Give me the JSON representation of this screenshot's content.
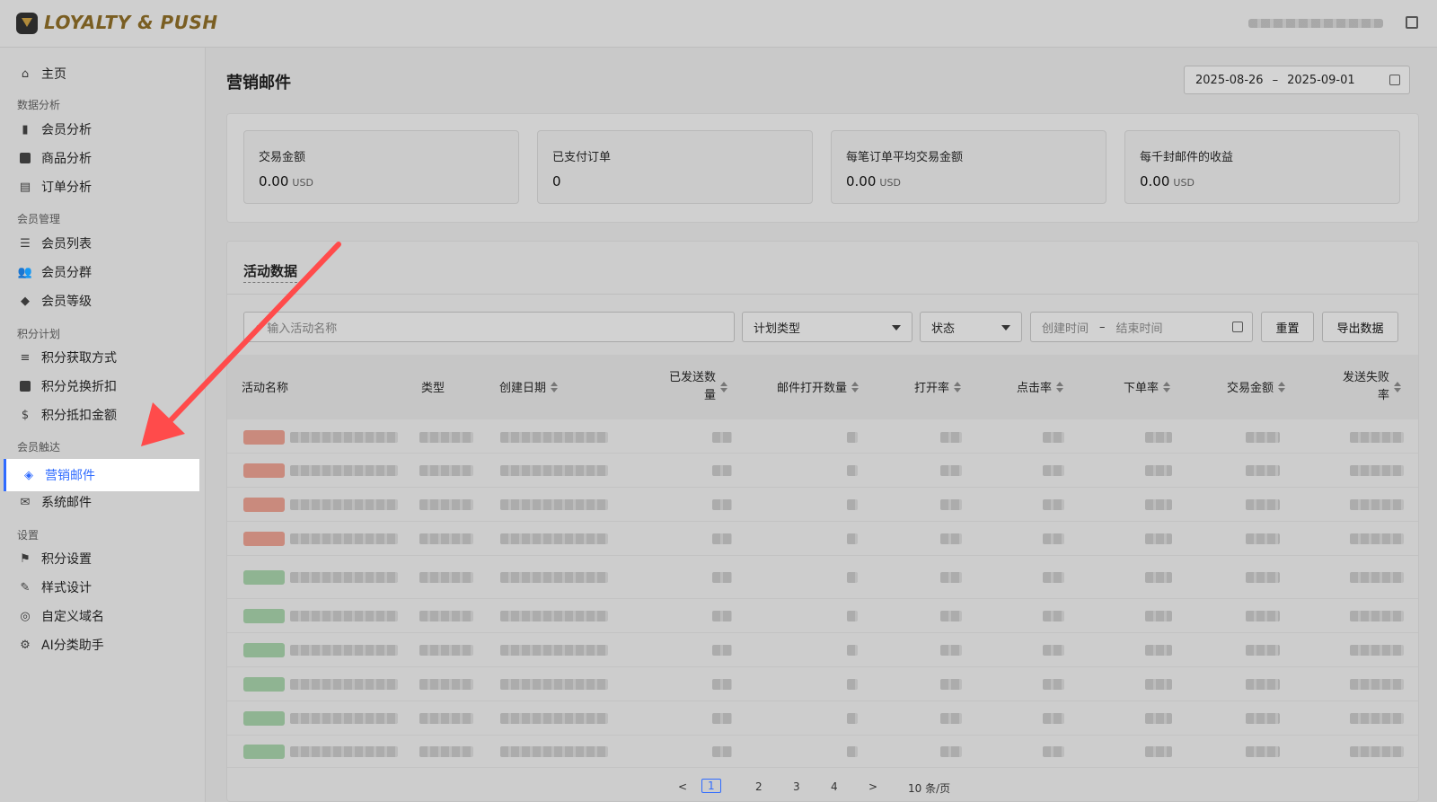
{
  "header": {
    "brand": "LOYALTY & PUSH"
  },
  "sidebar": {
    "groups": {
      "analytics": "数据分析",
      "members": "会员管理",
      "points": "积分计划",
      "reach": "会员触达",
      "settings": "设置"
    },
    "items": {
      "home": "主页",
      "member_analysis": "会员分析",
      "product_analysis": "商品分析",
      "order_analysis": "订单分析",
      "member_list": "会员列表",
      "member_segments": "会员分群",
      "member_levels": "会员等级",
      "points_earn": "积分获取方式",
      "points_redeem": "积分兑换折扣",
      "points_deduct": "积分抵扣金额",
      "marketing_email": "营销邮件",
      "system_email": "系统邮件",
      "points_settings": "积分设置",
      "style_design": "样式设计",
      "custom_domain": "自定义域名",
      "ai_assistant": "AI分类助手"
    }
  },
  "main": {
    "title": "营销邮件",
    "date_start": "2025-08-26",
    "date_sep": "–",
    "date_end": "2025-09-01",
    "stats": [
      {
        "label": "交易金额",
        "value": "0.00",
        "unit": "USD"
      },
      {
        "label": "已支付订单",
        "value": "0",
        "unit": ""
      },
      {
        "label": "每笔订单平均交易金额",
        "value": "0.00",
        "unit": "USD"
      },
      {
        "label": "每千封邮件的收益",
        "value": "0.00",
        "unit": "USD"
      }
    ],
    "activity": {
      "title": "活动数据",
      "search_placeholder": "输入活动名称",
      "plan_type": "计划类型",
      "status": "状态",
      "create_time": "创建时间",
      "range_sep": "–",
      "end_time": "结束时间",
      "reset": "重置",
      "export": "导出数据",
      "columns": [
        "活动名称",
        "类型",
        "创建日期",
        "已发送数量",
        "邮件打开数量",
        "打开率",
        "点击率",
        "下单率",
        "交易金额",
        "发送失败率"
      ],
      "pagination": {
        "prev": "<",
        "pages": [
          "1",
          "2",
          "3",
          "4"
        ],
        "next": ">",
        "page_size": "10 条/页"
      }
    }
  }
}
